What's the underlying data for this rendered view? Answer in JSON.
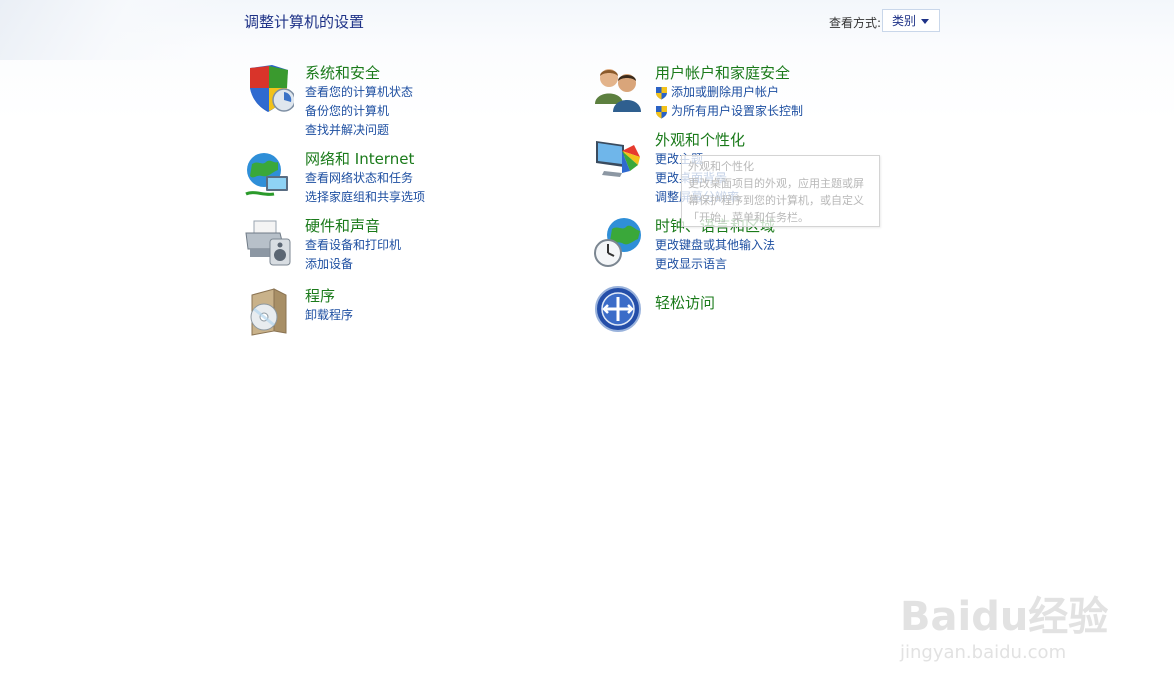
{
  "header": {
    "title": "调整计算机的设置",
    "view_label": "查看方式:",
    "view_value": "类别"
  },
  "categories": [
    {
      "title": "系统和安全",
      "icon": "shield-icon",
      "links": [
        "查看您的计算机状态",
        "备份您的计算机",
        "查找并解决问题"
      ]
    },
    {
      "title": "网络和 Internet",
      "icon": "network-globe-icon",
      "links": [
        "查看网络状态和任务",
        "选择家庭组和共享选项"
      ]
    },
    {
      "title": "硬件和声音",
      "icon": "printer-speaker-icon",
      "links": [
        "查看设备和打印机",
        "添加设备"
      ]
    },
    {
      "title": "程序",
      "icon": "programs-disc-icon",
      "links": [
        "卸载程序"
      ]
    },
    {
      "title": "用户帐户和家庭安全",
      "icon": "users-icon",
      "links": [
        "添加或删除用户帐户",
        "为所有用户设置家长控制"
      ]
    },
    {
      "title": "外观和个性化",
      "icon": "monitor-palette-icon",
      "links": [
        "更改主题",
        "更改桌面背景",
        "调整屏幕分辨率"
      ]
    },
    {
      "title": "时钟、语言和区域",
      "icon": "clock-globe-icon",
      "links": [
        "更改键盘或其他输入法",
        "更改显示语言"
      ]
    },
    {
      "title": "轻松访问",
      "icon": "ease-of-access-icon",
      "links": []
    }
  ],
  "tooltip": {
    "title": "外观和个性化",
    "body": "更改桌面项目的外观，应用主题或屏幕保护程序到您的计算机，或自定义「开始」菜单和任务栏。"
  },
  "watermark": {
    "main": "Baidu经验",
    "sub": "jingyan.baidu.com"
  },
  "colors": {
    "title_blue": "#1e3287",
    "category_green": "#1a7a1a",
    "link_blue": "#1e4fa1"
  }
}
